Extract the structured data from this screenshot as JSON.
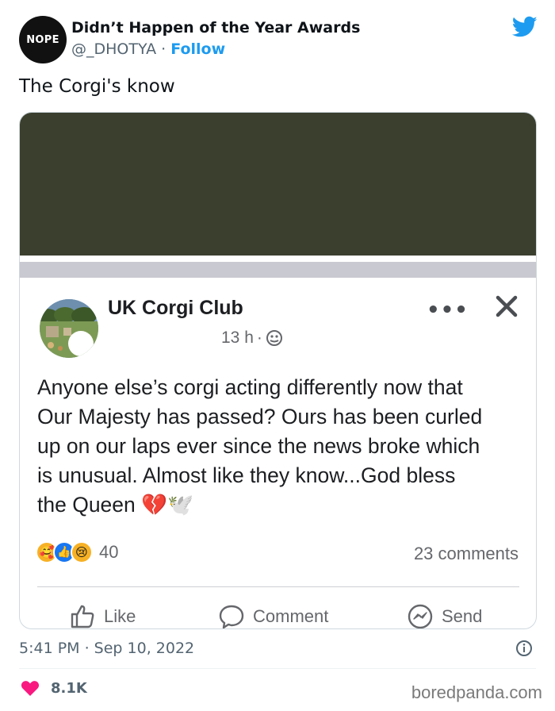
{
  "tweet": {
    "avatar_text": "NOPE",
    "display_name": "Didn’t Happen of the Year Awards",
    "handle": "@_DHOTYA",
    "separator": "·",
    "follow_label": "Follow",
    "text": "The Corgi's know",
    "timestamp": "5:41 PM · Sep 10, 2022",
    "like_count": "8.1K",
    "twitter_icon": "twitter-bird-icon",
    "info_icon": "info-icon",
    "heart_icon": "heart-icon",
    "colors": {
      "accent": "#1d9bf0",
      "heart": "#f91880",
      "media_dark": "#3b3f2e"
    }
  },
  "fb_post": {
    "page_name": "UK Corgi Club",
    "time": "13 h",
    "time_separator": "·",
    "audience_icon": "globe-icon",
    "more_icon": "more-dots-icon",
    "more_label": "•••",
    "close_icon": "close-icon",
    "body_lines": [
      "Anyone else’s corgi acting differently now that",
      "Our Majesty has passed? Ours has been curled",
      "up on our laps ever since the news broke which",
      "is unusual. Almost like they know...God bless",
      "the Queen 💔🕊️"
    ],
    "reactions": {
      "icons": [
        "care-reaction-icon",
        "like-reaction-icon",
        "sad-reaction-icon"
      ],
      "care_glyph": "🥰",
      "like_glyph": "👍",
      "sad_glyph": "😢",
      "count": "40"
    },
    "comments": "23 comments",
    "actions": [
      {
        "label": "Like",
        "icon": "thumbs-up-icon"
      },
      {
        "label": "Comment",
        "icon": "comment-icon"
      },
      {
        "label": "Send",
        "icon": "messenger-icon"
      }
    ]
  },
  "watermark": "boredpanda.com"
}
